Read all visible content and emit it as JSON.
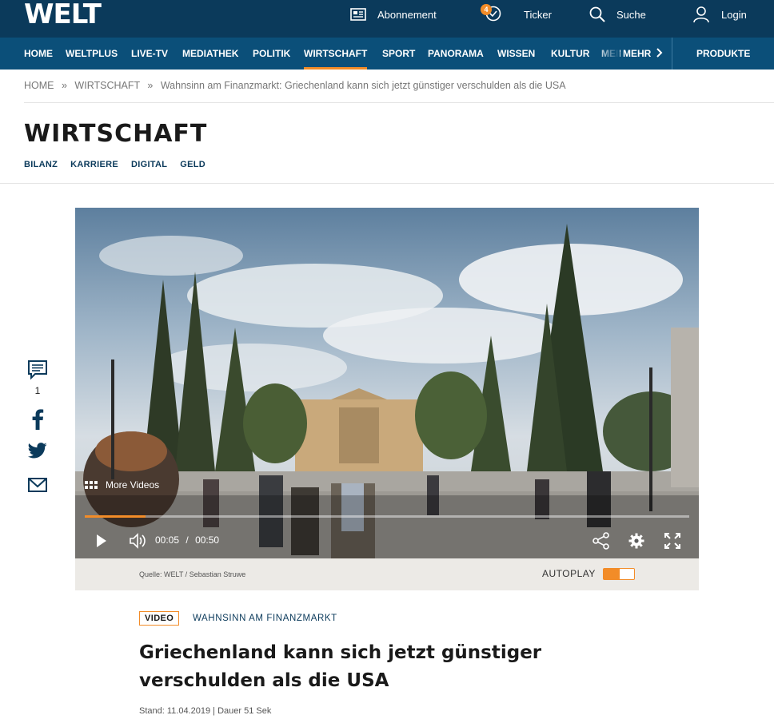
{
  "header": {
    "logo": "WELT",
    "abonnement": "Abonnement",
    "ticker": "Ticker",
    "ticker_badge": "4",
    "suche": "Suche",
    "login": "Login"
  },
  "nav": {
    "items": [
      "HOME",
      "WELTPLUS",
      "LIVE-TV",
      "MEDIATHEK",
      "POLITIK",
      "WIRTSCHAFT",
      "SPORT",
      "PANORAMA",
      "WISSEN",
      "KULTUR",
      "MEINUNG"
    ],
    "active": "WIRTSCHAFT",
    "more": "MEHR",
    "produkte": "PRODUKTE"
  },
  "breadcrumb": {
    "home": "HOME",
    "section": "WIRTSCHAFT",
    "current": "Wahnsinn am Finanzmarkt: Griechenland kann sich jetzt günstiger verschulden als die USA",
    "separator": "»"
  },
  "section": {
    "title": "WIRTSCHAFT",
    "subnav": [
      "BILANZ",
      "KARRIERE",
      "DIGITAL",
      "GELD"
    ]
  },
  "share": {
    "comment_count": "1",
    "icons": [
      "comment-icon",
      "facebook-icon",
      "twitter-icon",
      "mail-icon"
    ]
  },
  "video": {
    "more_videos": "More Videos",
    "current_time": "00:05",
    "time_separator": "/",
    "duration": "00:50",
    "progress": 0.1,
    "source": "Quelle: WELT / Sebastian Struwe",
    "autoplay_label": "AUTOPLAY",
    "autoplay_on": true
  },
  "article": {
    "tag": "VIDEO",
    "kicker": "WAHNSINN AM FINANZMARKT",
    "headline": "Griechenland kann sich jetzt günstiger verschulden als die USA",
    "meta": "Stand: 11.04.2019 | Dauer 51 Sek"
  },
  "colors": {
    "topbar": "#0b3a5b",
    "navbar": "#0b4f79",
    "accent": "#f28c28"
  }
}
